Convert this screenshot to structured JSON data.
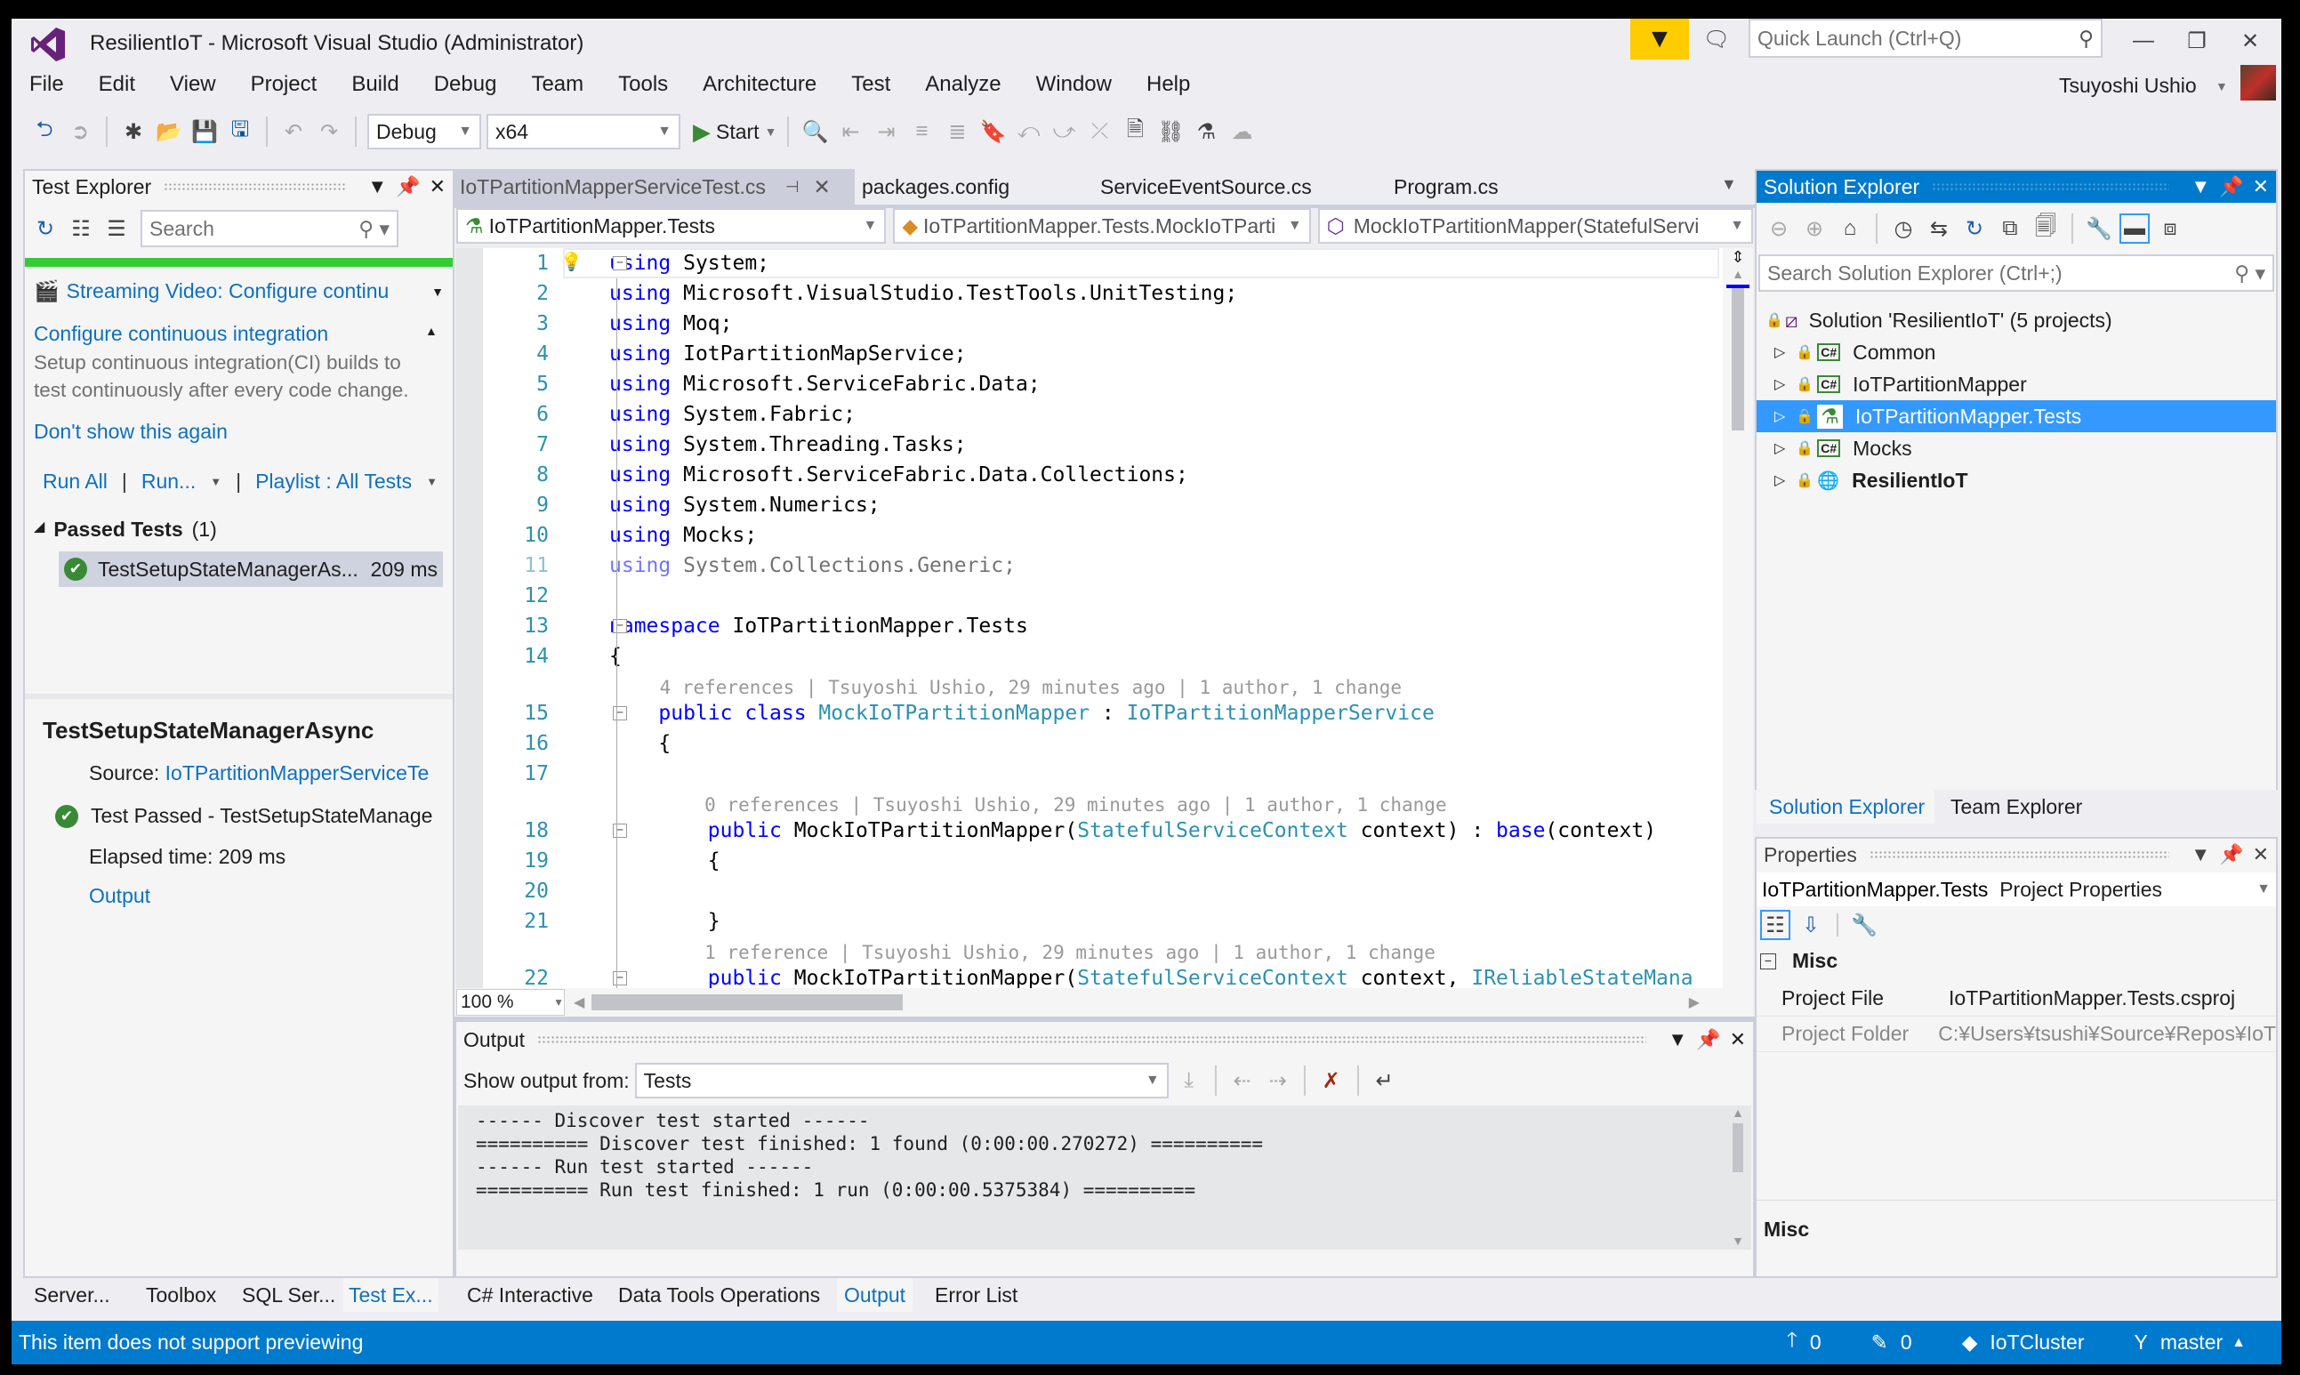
{
  "titlebar": {
    "title": "ResilientIoT - Microsoft Visual Studio (Administrator)",
    "quick_launch_placeholder": "Quick Launch (Ctrl+Q)",
    "user": "Tsuyoshi Ushio"
  },
  "menu": [
    "File",
    "Edit",
    "View",
    "Project",
    "Build",
    "Debug",
    "Team",
    "Tools",
    "Architecture",
    "Test",
    "Analyze",
    "Window",
    "Help"
  ],
  "toolbar": {
    "configuration": "Debug",
    "platform": "x64",
    "start_label": "Start"
  },
  "test_explorer": {
    "title": "Test Explorer",
    "search_placeholder": "Search",
    "progress_pct": 100,
    "video_link": "Streaming Video: Configure continu",
    "ci_title": "Configure continuous integration",
    "ci_desc1": "Setup continuous integration(CI) builds to",
    "ci_desc2": "test continuously after every code change.",
    "dont_show": "Don't show this again",
    "run_all": "Run All",
    "run": "Run...",
    "playlist": "Playlist : All Tests",
    "group": "Passed Tests",
    "group_count": "(1)",
    "test_name": "TestSetupStateManagerAs...",
    "test_time": "209 ms",
    "detail_title": "TestSetupStateManagerAsync",
    "source_label": "Source:",
    "source_value": "IoTPartitionMapperServiceTe",
    "result": "Test Passed - TestSetupStateManage",
    "elapsed": "Elapsed time: 209 ms",
    "output_link": "Output"
  },
  "left_tabs": [
    "Server...",
    "Toolbox",
    "SQL Ser...",
    "Test Ex..."
  ],
  "editor": {
    "tabs": [
      "IoTPartitionMapperServiceTest.cs",
      "packages.config",
      "ServiceEventSource.cs",
      "Program.cs"
    ],
    "nav_project": "IoTPartitionMapper.Tests",
    "nav_class": "IoTPartitionMapper.Tests.MockIoTParti",
    "nav_member": "MockIoTPartitionMapper(StatefulServi",
    "zoom": "100 %",
    "lines": [
      {
        "n": "1",
        "t": [
          [
            "kw",
            "using"
          ],
          [
            "pl",
            " System;"
          ]
        ]
      },
      {
        "n": "2",
        "t": [
          [
            "kw",
            "using"
          ],
          [
            "pl",
            " Microsoft.VisualStudio.TestTools.UnitTesting;"
          ]
        ]
      },
      {
        "n": "3",
        "t": [
          [
            "kw",
            "using"
          ],
          [
            "pl",
            " Moq;"
          ]
        ]
      },
      {
        "n": "4",
        "t": [
          [
            "kw",
            "using"
          ],
          [
            "pl",
            " IotPartitionMapService;"
          ]
        ]
      },
      {
        "n": "5",
        "t": [
          [
            "kw",
            "using"
          ],
          [
            "pl",
            " Microsoft.ServiceFabric.Data;"
          ]
        ]
      },
      {
        "n": "6",
        "t": [
          [
            "kw",
            "using"
          ],
          [
            "pl",
            " System.Fabric;"
          ]
        ]
      },
      {
        "n": "7",
        "t": [
          [
            "kw",
            "using"
          ],
          [
            "pl",
            " System.Threading.Tasks;"
          ]
        ]
      },
      {
        "n": "8",
        "t": [
          [
            "kw",
            "using"
          ],
          [
            "pl",
            " Microsoft.ServiceFabric.Data.Collections;"
          ]
        ]
      },
      {
        "n": "9",
        "t": [
          [
            "kw",
            "using"
          ],
          [
            "pl",
            " System.Numerics;"
          ]
        ]
      },
      {
        "n": "10",
        "t": [
          [
            "kw",
            "using"
          ],
          [
            "pl",
            " Mocks;"
          ]
        ]
      },
      {
        "n": "11",
        "dim": true,
        "t": [
          [
            "kw",
            "using"
          ],
          [
            "pl",
            " System.Collections.Generic;"
          ]
        ]
      },
      {
        "n": "12",
        "t": []
      },
      {
        "n": "13",
        "t": [
          [
            "kw",
            "namespace"
          ],
          [
            "pl",
            " IoTPartitionMapper.Tests"
          ]
        ]
      },
      {
        "n": "14",
        "t": [
          [
            "pl",
            "{"
          ]
        ]
      },
      {
        "lens": "    4 references | Tsuyoshi Ushio, 29 minutes ago | 1 author, 1 change"
      },
      {
        "n": "15",
        "t": [
          [
            "pl",
            "    "
          ],
          [
            "kw",
            "public class"
          ],
          [
            "pl",
            " "
          ],
          [
            "ty",
            "MockIoTPartitionMapper"
          ],
          [
            "pl",
            " : "
          ],
          [
            "ty",
            "IoTPartitionMapperService"
          ]
        ]
      },
      {
        "n": "16",
        "t": [
          [
            "pl",
            "    {"
          ]
        ]
      },
      {
        "n": "17",
        "t": []
      },
      {
        "lens": "        0 references | Tsuyoshi Ushio, 29 minutes ago | 1 author, 1 change"
      },
      {
        "n": "18",
        "t": [
          [
            "pl",
            "        "
          ],
          [
            "kw",
            "public"
          ],
          [
            "pl",
            " MockIoTPartitionMapper("
          ],
          [
            "ty",
            "StatefulServiceContext"
          ],
          [
            "pl",
            " context) : "
          ],
          [
            "kw",
            "base"
          ],
          [
            "pl",
            "(context)"
          ]
        ]
      },
      {
        "n": "19",
        "t": [
          [
            "pl",
            "        {"
          ]
        ]
      },
      {
        "n": "20",
        "t": []
      },
      {
        "n": "21",
        "t": [
          [
            "pl",
            "        }"
          ]
        ]
      },
      {
        "lens": "        1 reference | Tsuyoshi Ushio, 29 minutes ago | 1 author, 1 change"
      },
      {
        "n": "22",
        "t": [
          [
            "pl",
            "        "
          ],
          [
            "kw",
            "public"
          ],
          [
            "pl",
            " MockIoTPartitionMapper("
          ],
          [
            "ty",
            "StatefulServiceContext"
          ],
          [
            "pl",
            " context, "
          ],
          [
            "ty",
            "IReliableStateMana"
          ]
        ]
      }
    ]
  },
  "output": {
    "title": "Output",
    "show_from_label": "Show output from:",
    "source": "Tests",
    "lines": [
      "------ Discover test started ------",
      "========== Discover test finished: 1 found (0:00:00.270272) ==========",
      "------ Run test started ------",
      "========== Run test finished: 1 run (0:00:00.5375384) =========="
    ]
  },
  "bottom_tabs": [
    "C# Interactive",
    "Data Tools Operations",
    "Output",
    "Error List"
  ],
  "solution_explorer": {
    "title": "Solution Explorer",
    "search_placeholder": "Search Solution Explorer (Ctrl+;)",
    "solution": "Solution 'ResilientIoT' (5 projects)",
    "projects": [
      {
        "name": "Common",
        "icon": "csharp-project"
      },
      {
        "name": "IoTPartitionMapper",
        "icon": "csharp-project"
      },
      {
        "name": "IoTPartitionMapper.Tests",
        "icon": "test-project",
        "selected": true
      },
      {
        "name": "Mocks",
        "icon": "csharp-project"
      },
      {
        "name": "ResilientIoT",
        "icon": "service-fabric-project",
        "bold": true
      }
    ],
    "tabs": [
      "Solution Explorer",
      "Team Explorer"
    ]
  },
  "properties": {
    "title": "Properties",
    "object": "IoTPartitionMapper.Tests",
    "object_type": "Project Properties",
    "category": "Misc",
    "rows": [
      {
        "name": "Project File",
        "value": "IoTPartitionMapper.Tests.csproj"
      },
      {
        "name": "Project Folder",
        "value": "C:¥Users¥tsushi¥Source¥Repos¥IoT"
      }
    ],
    "desc_title": "Misc"
  },
  "status": {
    "message": "This item does not support previewing",
    "push": "0",
    "changes": "0",
    "repo": "IoTCluster",
    "branch": "master"
  },
  "colors": {
    "accent": "#007acc",
    "selection": "#3399ff",
    "progress": "#33cc33",
    "link": "#0e70c0"
  }
}
